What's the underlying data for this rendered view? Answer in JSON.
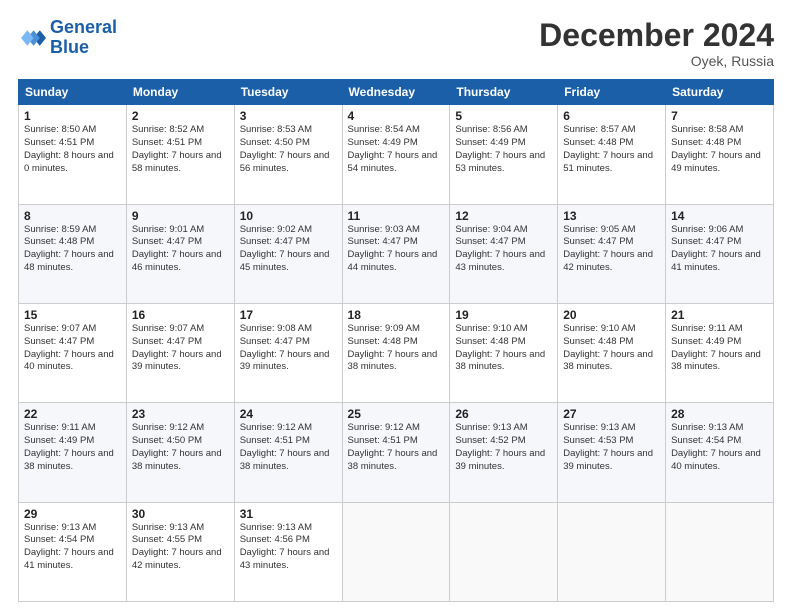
{
  "header": {
    "logo_line1": "General",
    "logo_line2": "Blue",
    "month_title": "December 2024",
    "location": "Oyek, Russia"
  },
  "weekdays": [
    "Sunday",
    "Monday",
    "Tuesday",
    "Wednesday",
    "Thursday",
    "Friday",
    "Saturday"
  ],
  "weeks": [
    [
      {
        "day": "1",
        "sunrise": "Sunrise: 8:50 AM",
        "sunset": "Sunset: 4:51 PM",
        "daylight": "Daylight: 8 hours and 0 minutes."
      },
      {
        "day": "2",
        "sunrise": "Sunrise: 8:52 AM",
        "sunset": "Sunset: 4:51 PM",
        "daylight": "Daylight: 7 hours and 58 minutes."
      },
      {
        "day": "3",
        "sunrise": "Sunrise: 8:53 AM",
        "sunset": "Sunset: 4:50 PM",
        "daylight": "Daylight: 7 hours and 56 minutes."
      },
      {
        "day": "4",
        "sunrise": "Sunrise: 8:54 AM",
        "sunset": "Sunset: 4:49 PM",
        "daylight": "Daylight: 7 hours and 54 minutes."
      },
      {
        "day": "5",
        "sunrise": "Sunrise: 8:56 AM",
        "sunset": "Sunset: 4:49 PM",
        "daylight": "Daylight: 7 hours and 53 minutes."
      },
      {
        "day": "6",
        "sunrise": "Sunrise: 8:57 AM",
        "sunset": "Sunset: 4:48 PM",
        "daylight": "Daylight: 7 hours and 51 minutes."
      },
      {
        "day": "7",
        "sunrise": "Sunrise: 8:58 AM",
        "sunset": "Sunset: 4:48 PM",
        "daylight": "Daylight: 7 hours and 49 minutes."
      }
    ],
    [
      {
        "day": "8",
        "sunrise": "Sunrise: 8:59 AM",
        "sunset": "Sunset: 4:48 PM",
        "daylight": "Daylight: 7 hours and 48 minutes."
      },
      {
        "day": "9",
        "sunrise": "Sunrise: 9:01 AM",
        "sunset": "Sunset: 4:47 PM",
        "daylight": "Daylight: 7 hours and 46 minutes."
      },
      {
        "day": "10",
        "sunrise": "Sunrise: 9:02 AM",
        "sunset": "Sunset: 4:47 PM",
        "daylight": "Daylight: 7 hours and 45 minutes."
      },
      {
        "day": "11",
        "sunrise": "Sunrise: 9:03 AM",
        "sunset": "Sunset: 4:47 PM",
        "daylight": "Daylight: 7 hours and 44 minutes."
      },
      {
        "day": "12",
        "sunrise": "Sunrise: 9:04 AM",
        "sunset": "Sunset: 4:47 PM",
        "daylight": "Daylight: 7 hours and 43 minutes."
      },
      {
        "day": "13",
        "sunrise": "Sunrise: 9:05 AM",
        "sunset": "Sunset: 4:47 PM",
        "daylight": "Daylight: 7 hours and 42 minutes."
      },
      {
        "day": "14",
        "sunrise": "Sunrise: 9:06 AM",
        "sunset": "Sunset: 4:47 PM",
        "daylight": "Daylight: 7 hours and 41 minutes."
      }
    ],
    [
      {
        "day": "15",
        "sunrise": "Sunrise: 9:07 AM",
        "sunset": "Sunset: 4:47 PM",
        "daylight": "Daylight: 7 hours and 40 minutes."
      },
      {
        "day": "16",
        "sunrise": "Sunrise: 9:07 AM",
        "sunset": "Sunset: 4:47 PM",
        "daylight": "Daylight: 7 hours and 39 minutes."
      },
      {
        "day": "17",
        "sunrise": "Sunrise: 9:08 AM",
        "sunset": "Sunset: 4:47 PM",
        "daylight": "Daylight: 7 hours and 39 minutes."
      },
      {
        "day": "18",
        "sunrise": "Sunrise: 9:09 AM",
        "sunset": "Sunset: 4:48 PM",
        "daylight": "Daylight: 7 hours and 38 minutes."
      },
      {
        "day": "19",
        "sunrise": "Sunrise: 9:10 AM",
        "sunset": "Sunset: 4:48 PM",
        "daylight": "Daylight: 7 hours and 38 minutes."
      },
      {
        "day": "20",
        "sunrise": "Sunrise: 9:10 AM",
        "sunset": "Sunset: 4:48 PM",
        "daylight": "Daylight: 7 hours and 38 minutes."
      },
      {
        "day": "21",
        "sunrise": "Sunrise: 9:11 AM",
        "sunset": "Sunset: 4:49 PM",
        "daylight": "Daylight: 7 hours and 38 minutes."
      }
    ],
    [
      {
        "day": "22",
        "sunrise": "Sunrise: 9:11 AM",
        "sunset": "Sunset: 4:49 PM",
        "daylight": "Daylight: 7 hours and 38 minutes."
      },
      {
        "day": "23",
        "sunrise": "Sunrise: 9:12 AM",
        "sunset": "Sunset: 4:50 PM",
        "daylight": "Daylight: 7 hours and 38 minutes."
      },
      {
        "day": "24",
        "sunrise": "Sunrise: 9:12 AM",
        "sunset": "Sunset: 4:51 PM",
        "daylight": "Daylight: 7 hours and 38 minutes."
      },
      {
        "day": "25",
        "sunrise": "Sunrise: 9:12 AM",
        "sunset": "Sunset: 4:51 PM",
        "daylight": "Daylight: 7 hours and 38 minutes."
      },
      {
        "day": "26",
        "sunrise": "Sunrise: 9:13 AM",
        "sunset": "Sunset: 4:52 PM",
        "daylight": "Daylight: 7 hours and 39 minutes."
      },
      {
        "day": "27",
        "sunrise": "Sunrise: 9:13 AM",
        "sunset": "Sunset: 4:53 PM",
        "daylight": "Daylight: 7 hours and 39 minutes."
      },
      {
        "day": "28",
        "sunrise": "Sunrise: 9:13 AM",
        "sunset": "Sunset: 4:54 PM",
        "daylight": "Daylight: 7 hours and 40 minutes."
      }
    ],
    [
      {
        "day": "29",
        "sunrise": "Sunrise: 9:13 AM",
        "sunset": "Sunset: 4:54 PM",
        "daylight": "Daylight: 7 hours and 41 minutes."
      },
      {
        "day": "30",
        "sunrise": "Sunrise: 9:13 AM",
        "sunset": "Sunset: 4:55 PM",
        "daylight": "Daylight: 7 hours and 42 minutes."
      },
      {
        "day": "31",
        "sunrise": "Sunrise: 9:13 AM",
        "sunset": "Sunset: 4:56 PM",
        "daylight": "Daylight: 7 hours and 43 minutes."
      },
      null,
      null,
      null,
      null
    ]
  ]
}
